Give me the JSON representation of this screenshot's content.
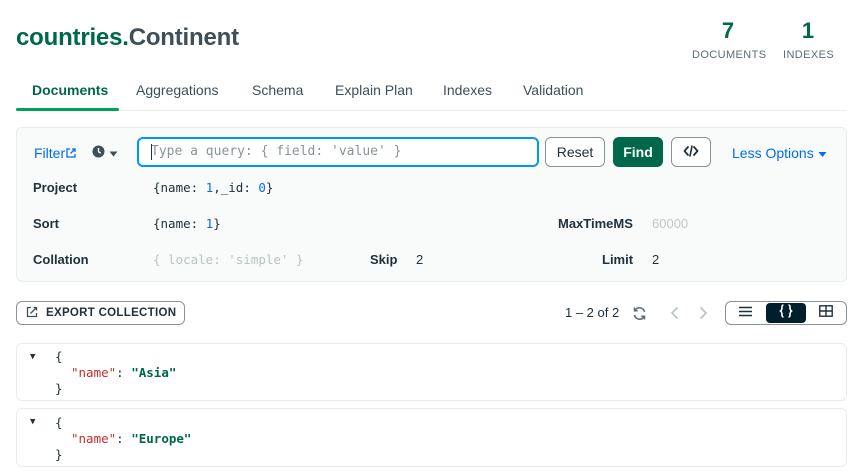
{
  "namespace": {
    "database": "countries",
    "separator": ".",
    "collection": "Continent"
  },
  "stats": [
    {
      "value": "7",
      "label": "DOCUMENTS"
    },
    {
      "value": "1",
      "label": "INDEXES"
    }
  ],
  "tabs": [
    {
      "label": "Documents",
      "active": true
    },
    {
      "label": "Aggregations",
      "active": false
    },
    {
      "label": "Schema",
      "active": false
    },
    {
      "label": "Explain Plan",
      "active": false
    },
    {
      "label": "Indexes",
      "active": false
    },
    {
      "label": "Validation",
      "active": false
    }
  ],
  "query_bar": {
    "filter_label": "Filter",
    "filter_placeholder": "Type a query: { field: 'value' }",
    "reset_label": "Reset",
    "find_label": "Find",
    "less_options_label": "Less Options",
    "project_label": "Project",
    "project_value": {
      "open": "{name: ",
      "name_val": "1",
      "mid": ",_id: ",
      "id_val": "0",
      "close": "}"
    },
    "sort_label": "Sort",
    "sort_value": {
      "open": "{name: ",
      "name_val": "1",
      "close": "}"
    },
    "maxtime_label": "MaxTimeMS",
    "maxtime_placeholder": "60000",
    "collation_label": "Collation",
    "collation_placeholder": "{ locale: 'simple' }",
    "skip_label": "Skip",
    "skip_value": "2",
    "limit_label": "Limit",
    "limit_value": "2"
  },
  "toolbar": {
    "export_label": "EXPORT COLLECTION",
    "pagination_text": "1 – 2 of 2"
  },
  "documents": [
    {
      "open": "{",
      "key": "\"name\"",
      "colon": ": ",
      "value": "\"Asia\"",
      "close": "}"
    },
    {
      "open": "{",
      "key": "\"name\"",
      "colon": ": ",
      "value": "\"Europe\"",
      "close": "}"
    }
  ],
  "colors": {
    "brand_green": "#00684a",
    "accent_blue": "#016bf8",
    "focus_blue": "#0498ec",
    "key_red": "#c22f2a",
    "dark": "#001e2b"
  }
}
